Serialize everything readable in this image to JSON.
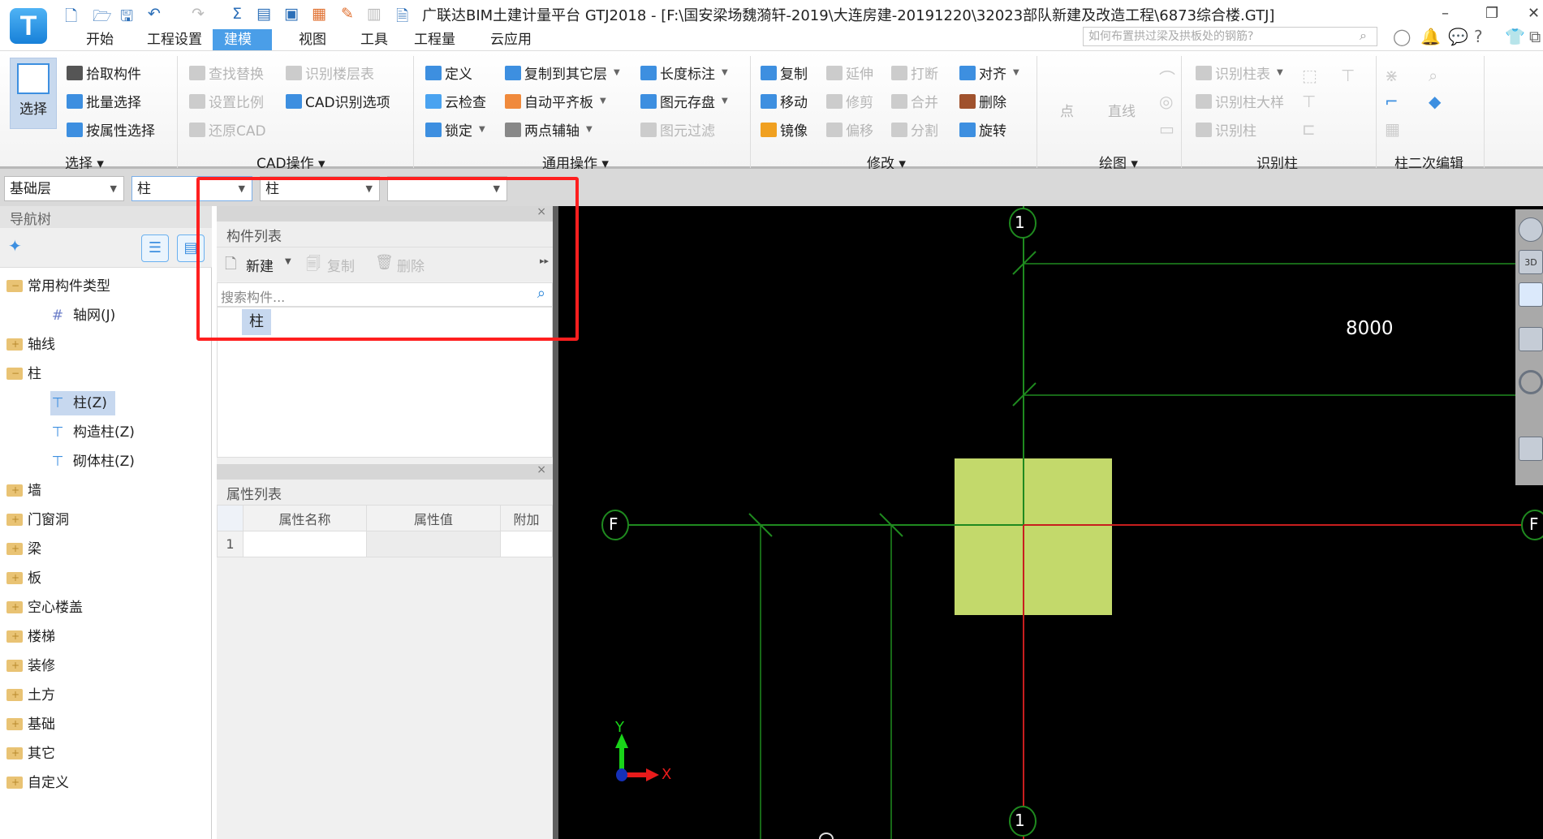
{
  "app": {
    "title": "广联达BIM土建计量平台 GTJ2018 - [F:\\国安梁场魏漪轩-2019\\大连房建-20191220\\32023部队新建及改造工程\\6873综合楼.GTJ]",
    "logo_letter": "T"
  },
  "tabs": [
    {
      "label": "开始",
      "active": false
    },
    {
      "label": "工程设置",
      "active": false
    },
    {
      "label": "建模",
      "active": true
    },
    {
      "label": "视图",
      "active": false
    },
    {
      "label": "工具",
      "active": false
    },
    {
      "label": "工程量",
      "active": false
    },
    {
      "label": "云应用",
      "active": false
    }
  ],
  "search": {
    "placeholder": "如何布置拱过梁及拱板处的钢筋?"
  },
  "ribbon": {
    "big_select_label": "选择",
    "groups": [
      {
        "label": "选择",
        "dropdown": true
      },
      {
        "label": "CAD操作",
        "dropdown": true
      },
      {
        "label": "通用操作",
        "dropdown": true
      },
      {
        "label": "修改",
        "dropdown": true
      },
      {
        "label": "绘图",
        "dropdown": true
      },
      {
        "label": "识别柱",
        "dropdown": false
      },
      {
        "label": "柱二次编辑",
        "dropdown": false
      }
    ],
    "items": [
      {
        "label": "拾取构件",
        "icon": "pick-icon",
        "color": "#555",
        "disabled": false,
        "dropdown": false
      },
      {
        "label": "批量选择",
        "icon": "batch-select-icon",
        "color": "#3d8fe0",
        "disabled": false,
        "dropdown": false
      },
      {
        "label": "按属性选择",
        "icon": "attr-select-icon",
        "color": "#3d8fe0",
        "disabled": false,
        "dropdown": false
      },
      {
        "label": "查找替换",
        "icon": "find-replace-icon",
        "color": "#ccc",
        "disabled": true,
        "dropdown": false
      },
      {
        "label": "设置比例",
        "icon": "scale-icon",
        "color": "#ccc",
        "disabled": true,
        "dropdown": false
      },
      {
        "label": "还原CAD",
        "icon": "restore-cad-icon",
        "color": "#ccc",
        "disabled": true,
        "dropdown": false
      },
      {
        "label": "识别楼层表",
        "icon": "floor-table-icon",
        "color": "#ccc",
        "disabled": true,
        "dropdown": false
      },
      {
        "label": "CAD识别选项",
        "icon": "cad-options-icon",
        "color": "#3d8fe0",
        "disabled": false,
        "dropdown": false
      },
      {
        "label": "定义",
        "icon": "define-icon",
        "color": "#3d8fe0",
        "disabled": false,
        "dropdown": false
      },
      {
        "label": "云检查",
        "icon": "cloud-check-icon",
        "color": "#4aa3f0",
        "disabled": false,
        "dropdown": false
      },
      {
        "label": "锁定",
        "icon": "lock-icon",
        "color": "#3d8fe0",
        "disabled": false,
        "dropdown": true
      },
      {
        "label": "复制到其它层",
        "icon": "copy-to-layer-icon",
        "color": "#3d8fe0",
        "disabled": false,
        "dropdown": true
      },
      {
        "label": "自动平齐板",
        "icon": "auto-align-slab-icon",
        "color": "#f08a3c",
        "disabled": false,
        "dropdown": true
      },
      {
        "label": "两点辅轴",
        "icon": "two-point-axis-icon",
        "color": "#888",
        "disabled": false,
        "dropdown": true
      },
      {
        "label": "长度标注",
        "icon": "length-dim-icon",
        "color": "#3d8fe0",
        "disabled": false,
        "dropdown": true
      },
      {
        "label": "图元存盘",
        "icon": "save-element-icon",
        "color": "#3d8fe0",
        "disabled": false,
        "dropdown": true
      },
      {
        "label": "图元过滤",
        "icon": "filter-icon",
        "color": "#ccc",
        "disabled": true,
        "dropdown": false
      },
      {
        "label": "复制",
        "icon": "copy-icon",
        "color": "#3d8fe0",
        "disabled": false,
        "dropdown": false
      },
      {
        "label": "移动",
        "icon": "move-icon",
        "color": "#3d8fe0",
        "disabled": false,
        "dropdown": false
      },
      {
        "label": "镜像",
        "icon": "mirror-icon",
        "color": "#f0a020",
        "disabled": false,
        "dropdown": false
      },
      {
        "label": "延伸",
        "icon": "extend-icon",
        "color": "#ccc",
        "disabled": true,
        "dropdown": false
      },
      {
        "label": "修剪",
        "icon": "trim-icon",
        "color": "#ccc",
        "disabled": true,
        "dropdown": false
      },
      {
        "label": "偏移",
        "icon": "offset-icon",
        "color": "#ccc",
        "disabled": true,
        "dropdown": false
      },
      {
        "label": "打断",
        "icon": "break-icon",
        "color": "#ccc",
        "disabled": true,
        "dropdown": false
      },
      {
        "label": "合并",
        "icon": "merge-icon",
        "color": "#ccc",
        "disabled": true,
        "dropdown": false
      },
      {
        "label": "分割",
        "icon": "split-icon",
        "color": "#ccc",
        "disabled": true,
        "dropdown": false
      },
      {
        "label": "对齐",
        "icon": "align-icon",
        "color": "#3d8fe0",
        "disabled": false,
        "dropdown": true
      },
      {
        "label": "删除",
        "icon": "delete-icon",
        "color": "#a0522d",
        "disabled": false,
        "dropdown": false
      },
      {
        "label": "旋转",
        "icon": "rotate-icon",
        "color": "#3d8fe0",
        "disabled": false,
        "dropdown": false
      },
      {
        "label": "点",
        "icon": "point-icon",
        "color": "#ccc",
        "disabled": true,
        "dropdown": false
      },
      {
        "label": "直线",
        "icon": "line-icon",
        "color": "#ccc",
        "disabled": true,
        "dropdown": false
      },
      {
        "label": "识别柱表",
        "icon": "recognize-column-table-icon",
        "color": "#ccc",
        "disabled": true,
        "dropdown": true
      },
      {
        "label": "识别柱大样",
        "icon": "recognize-column-detail-icon",
        "color": "#ccc",
        "disabled": true,
        "dropdown": false
      },
      {
        "label": "识别柱",
        "icon": "recognize-column-icon",
        "color": "#ccc",
        "disabled": true,
        "dropdown": false
      }
    ]
  },
  "toolbar": {
    "floor": "基础层",
    "category": "柱",
    "type": "柱",
    "component": ""
  },
  "nav": {
    "title": "导航树",
    "items": [
      {
        "label": "常用构件类型",
        "level": 0,
        "kind": "open"
      },
      {
        "label": "轴网(J)",
        "level": 1,
        "kind": "grid"
      },
      {
        "label": "轴线",
        "level": 0,
        "kind": "closed"
      },
      {
        "label": "柱",
        "level": 0,
        "kind": "open"
      },
      {
        "label": "柱(Z)",
        "level": 1,
        "kind": "column",
        "selected": true
      },
      {
        "label": "构造柱(Z)",
        "level": 1,
        "kind": "column"
      },
      {
        "label": "砌体柱(Z)",
        "level": 1,
        "kind": "column"
      },
      {
        "label": "墙",
        "level": 0,
        "kind": "closed"
      },
      {
        "label": "门窗洞",
        "level": 0,
        "kind": "closed"
      },
      {
        "label": "梁",
        "level": 0,
        "kind": "closed"
      },
      {
        "label": "板",
        "level": 0,
        "kind": "closed"
      },
      {
        "label": "空心楼盖",
        "level": 0,
        "kind": "closed"
      },
      {
        "label": "楼梯",
        "level": 0,
        "kind": "closed"
      },
      {
        "label": "装修",
        "level": 0,
        "kind": "closed"
      },
      {
        "label": "土方",
        "level": 0,
        "kind": "closed"
      },
      {
        "label": "基础",
        "level": 0,
        "kind": "closed"
      },
      {
        "label": "其它",
        "level": 0,
        "kind": "closed"
      },
      {
        "label": "自定义",
        "level": 0,
        "kind": "closed"
      }
    ]
  },
  "component_list": {
    "title": "构件列表",
    "new_label": "新建",
    "copy_label": "复制",
    "delete_label": "删除",
    "search_placeholder": "搜索构件...",
    "items": [
      "柱"
    ]
  },
  "property_list": {
    "title": "属性列表",
    "columns": [
      "属性名称",
      "属性值",
      "附加"
    ],
    "rows": [
      {
        "index": "1",
        "name": "",
        "value": "",
        "extra": ""
      }
    ]
  },
  "canvas": {
    "axis_labels": {
      "vertical": "1",
      "horizontal": "F"
    },
    "dimension": "8000",
    "ucs": {
      "x": "X",
      "y": "Y"
    },
    "column_color": "#c3d96b",
    "highlight_color": "#ff1f1f",
    "right_tools": [
      "orbit-icon",
      "3d-view-icon",
      "wireframe-icon",
      "solid-view-icon",
      "rotate-view-icon",
      "layer-list-icon"
    ],
    "view_3d_label": "3D"
  }
}
